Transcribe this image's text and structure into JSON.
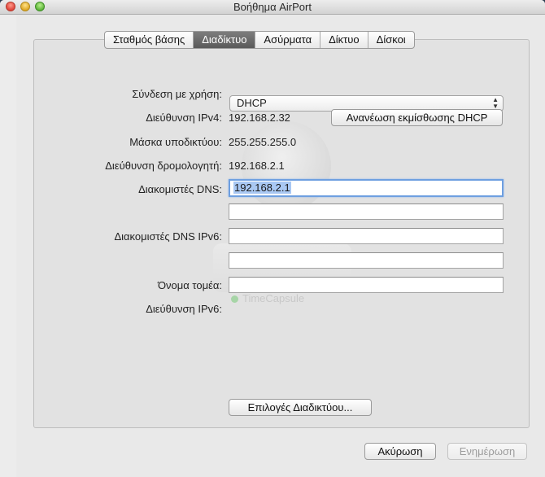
{
  "window": {
    "title": "Βοήθημα AirPort"
  },
  "tabs": [
    {
      "label": "Σταθμός βάσης",
      "active": false
    },
    {
      "label": "Διαδίκτυο",
      "active": true
    },
    {
      "label": "Ασύρματα",
      "active": false
    },
    {
      "label": "Δίκτυο",
      "active": false
    },
    {
      "label": "Δίσκοι",
      "active": false
    }
  ],
  "form": {
    "connect_using_label": "Σύνδεση με χρήση:",
    "connect_using_value": "DHCP",
    "ipv4_label": "Διεύθυνση IPv4:",
    "ipv4_value": "192.168.2.32",
    "renew_dhcp_button": "Ανανέωση εκμίσθωσης DHCP",
    "subnet_label": "Μάσκα υποδικτύου:",
    "subnet_value": "255.255.255.0",
    "router_label": "Διεύθυνση δρομολογητή:",
    "router_value": "192.168.2.1",
    "dns_label": "Διακομιστές DNS:",
    "dns_1": "192.168.2.1",
    "dns_2": "",
    "dns_ipv6_label": "Διακομιστές DNS IPv6:",
    "dns_ipv6_1": "",
    "dns_ipv6_2": "",
    "domain_label": "Όνομα τομέα:",
    "domain_value": "",
    "ipv6_label": "Διεύθυνση IPv6:",
    "internet_options_button": "Επιλογές Διαδικτύου..."
  },
  "watermark": {
    "device_name": "TimeCapsule"
  },
  "footer": {
    "cancel_button": "Ακύρωση",
    "update_button": "Ενημέρωση"
  }
}
